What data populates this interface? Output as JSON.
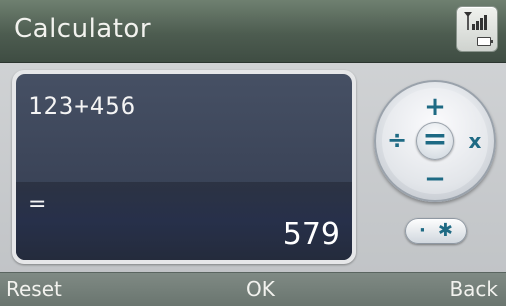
{
  "app": {
    "title": "Calculator"
  },
  "display": {
    "expression": "123+456",
    "equals_sign": "=",
    "result": "579"
  },
  "keypad": {
    "plus": "+",
    "minus": "−",
    "divide": "÷",
    "multiply": "x",
    "equals": "="
  },
  "extra_key": {
    "dot": "·",
    "star": "✱"
  },
  "softkeys": {
    "left": "Reset",
    "center": "OK",
    "right": "Back"
  },
  "colors": {
    "accent": "#1e6a84",
    "title_bar": "#4d5c50",
    "display_bg": "#3a4357"
  }
}
